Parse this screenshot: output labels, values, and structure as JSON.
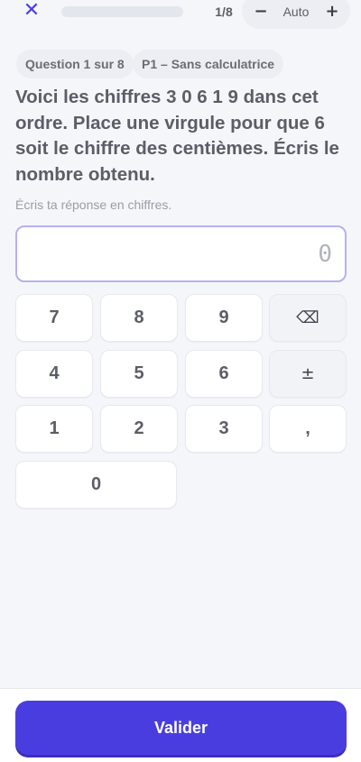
{
  "header": {
    "close_icon": "close-icon",
    "progress_fraction": 0.0,
    "counter": "1/8",
    "zoom": {
      "minus": "−",
      "label": "Auto",
      "plus": "+"
    }
  },
  "chips": {
    "question": "Question 1 sur 8",
    "section": "P1 – Sans calculatrice"
  },
  "question": {
    "text": "Voici les chiffres 3 0 6 1 9 dans cet ordre. Place une virgule pour que 6 soit le chiffre des centièmes. Écris le nombre obtenu.",
    "hint": "Écris ta réponse en chiffres."
  },
  "answer": {
    "value": "",
    "placeholder": "0"
  },
  "keypad": {
    "k7": "7",
    "k8": "8",
    "k9": "9",
    "backspace": "⌫",
    "k4": "4",
    "k5": "5",
    "k6": "6",
    "sign": "±",
    "k1": "1",
    "k2": "2",
    "k3": "3",
    "comma": ",",
    "k0": "0"
  },
  "footer": {
    "submit_label": "Valider"
  },
  "colors": {
    "accent": "#4a3de0",
    "background": "#f5f6fa",
    "text": "#5b5e66"
  }
}
